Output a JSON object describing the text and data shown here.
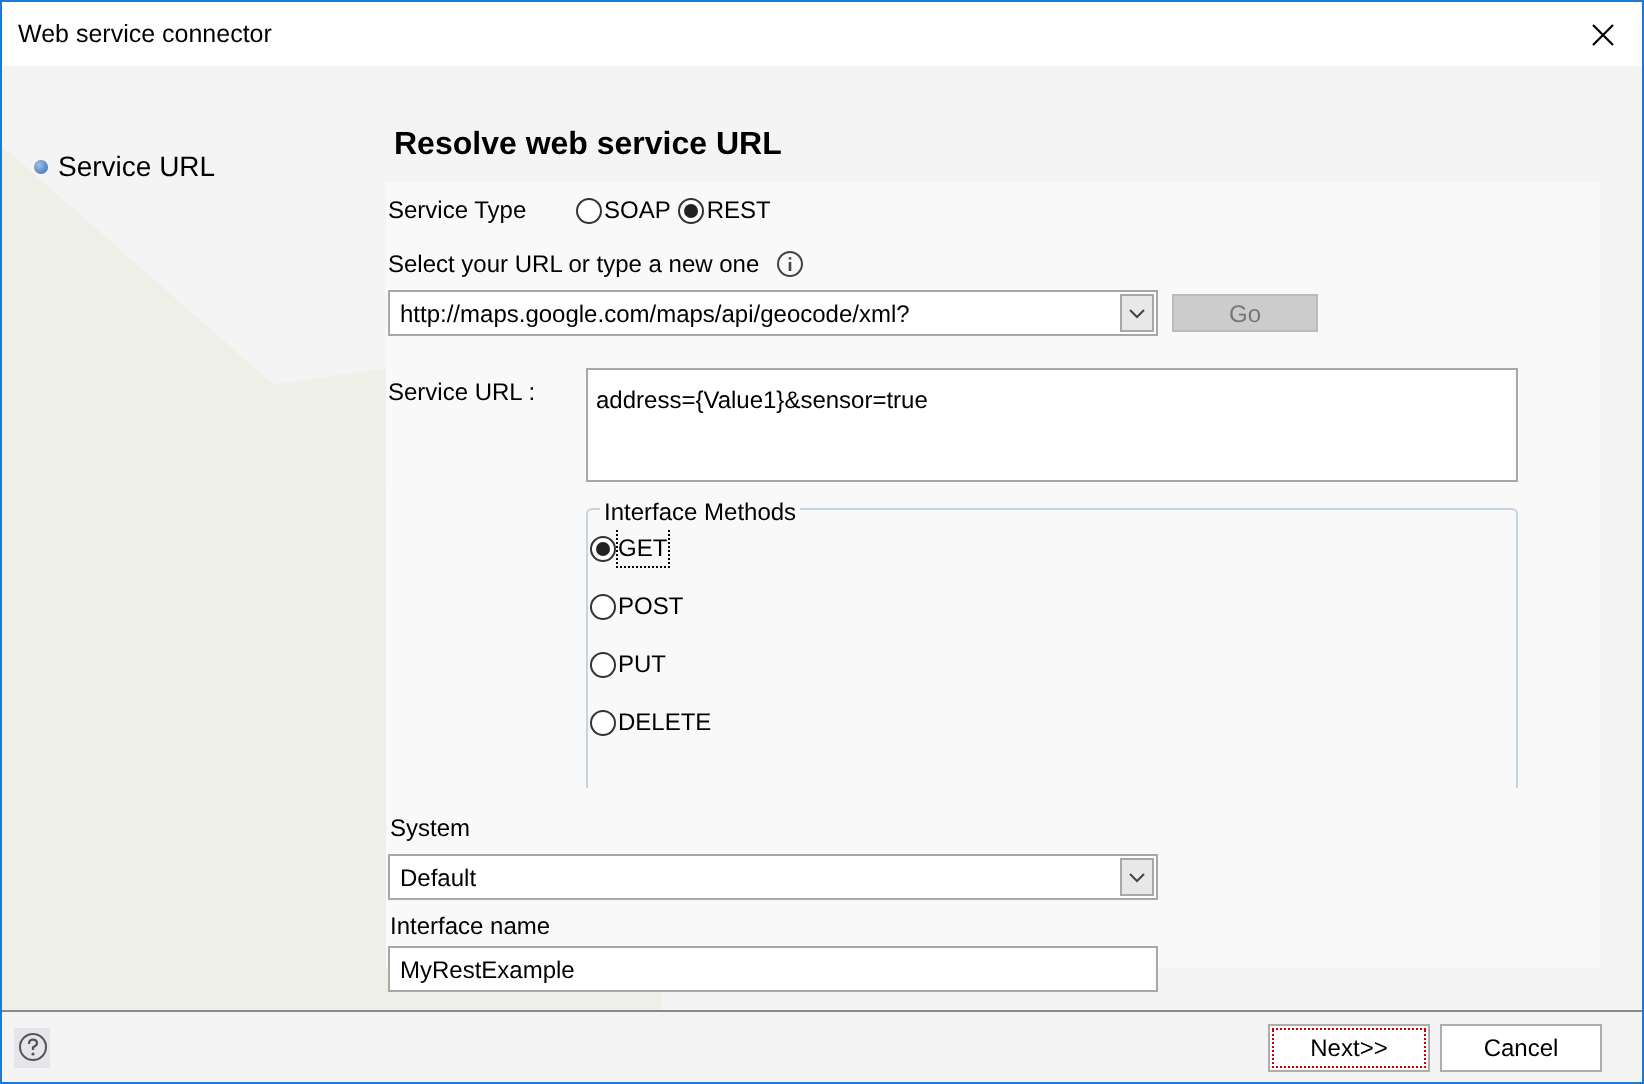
{
  "window": {
    "title": "Web service connector"
  },
  "sidebar": {
    "items": [
      {
        "label": "Service URL"
      }
    ]
  },
  "heading": "Resolve web service URL",
  "service_type": {
    "label": "Service Type",
    "options": [
      {
        "label": "SOAP",
        "selected": false
      },
      {
        "label": "REST",
        "selected": true
      }
    ]
  },
  "url_select": {
    "label": "Select your URL or type a new one",
    "value": "http://maps.google.com/maps/api/geocode/xml?"
  },
  "go_button": {
    "label": "Go",
    "disabled": true
  },
  "service_url": {
    "label": "Service URL :",
    "value": "address={Value1}&sensor=true"
  },
  "interface_methods": {
    "legend": "Interface Methods",
    "options": [
      {
        "label": "GET",
        "selected": true
      },
      {
        "label": "POST",
        "selected": false
      },
      {
        "label": "PUT",
        "selected": false
      },
      {
        "label": "DELETE",
        "selected": false
      }
    ]
  },
  "system": {
    "label": "System",
    "value": "Default"
  },
  "interface_name": {
    "label": "Interface name",
    "value": "MyRestExample"
  },
  "buttons": [
    {
      "label": "Next>>",
      "focused": true
    },
    {
      "label": "Cancel",
      "focused": false
    }
  ]
}
